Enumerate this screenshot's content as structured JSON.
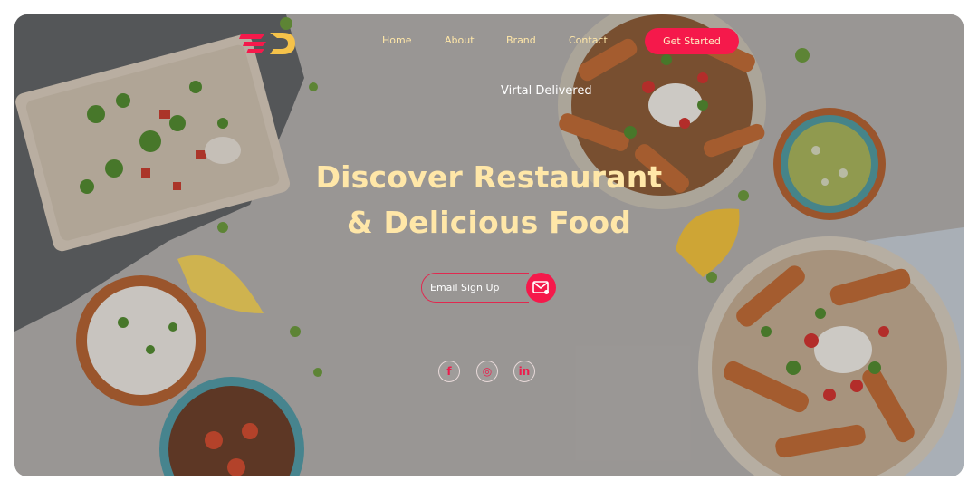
{
  "brand": {
    "logo_letter": "D",
    "accent": "#f5194b",
    "gold": "#ffe7a8"
  },
  "nav": {
    "items": [
      {
        "label": "Home"
      },
      {
        "label": "About"
      },
      {
        "label": "Brand"
      },
      {
        "label": "Contact"
      }
    ],
    "cta_label": "Get Started"
  },
  "hero": {
    "tagline": "Virtal Delivered",
    "title_line1": "Discover Restaurant",
    "title_line2": "& Delicious Food",
    "signup_placeholder": "Email Sign Up",
    "signup_icon": "mail-icon"
  },
  "social": [
    {
      "name": "facebook-icon",
      "glyph": "f"
    },
    {
      "name": "instagram-icon",
      "glyph": "◎"
    },
    {
      "name": "linkedin-icon",
      "glyph": "in"
    }
  ]
}
